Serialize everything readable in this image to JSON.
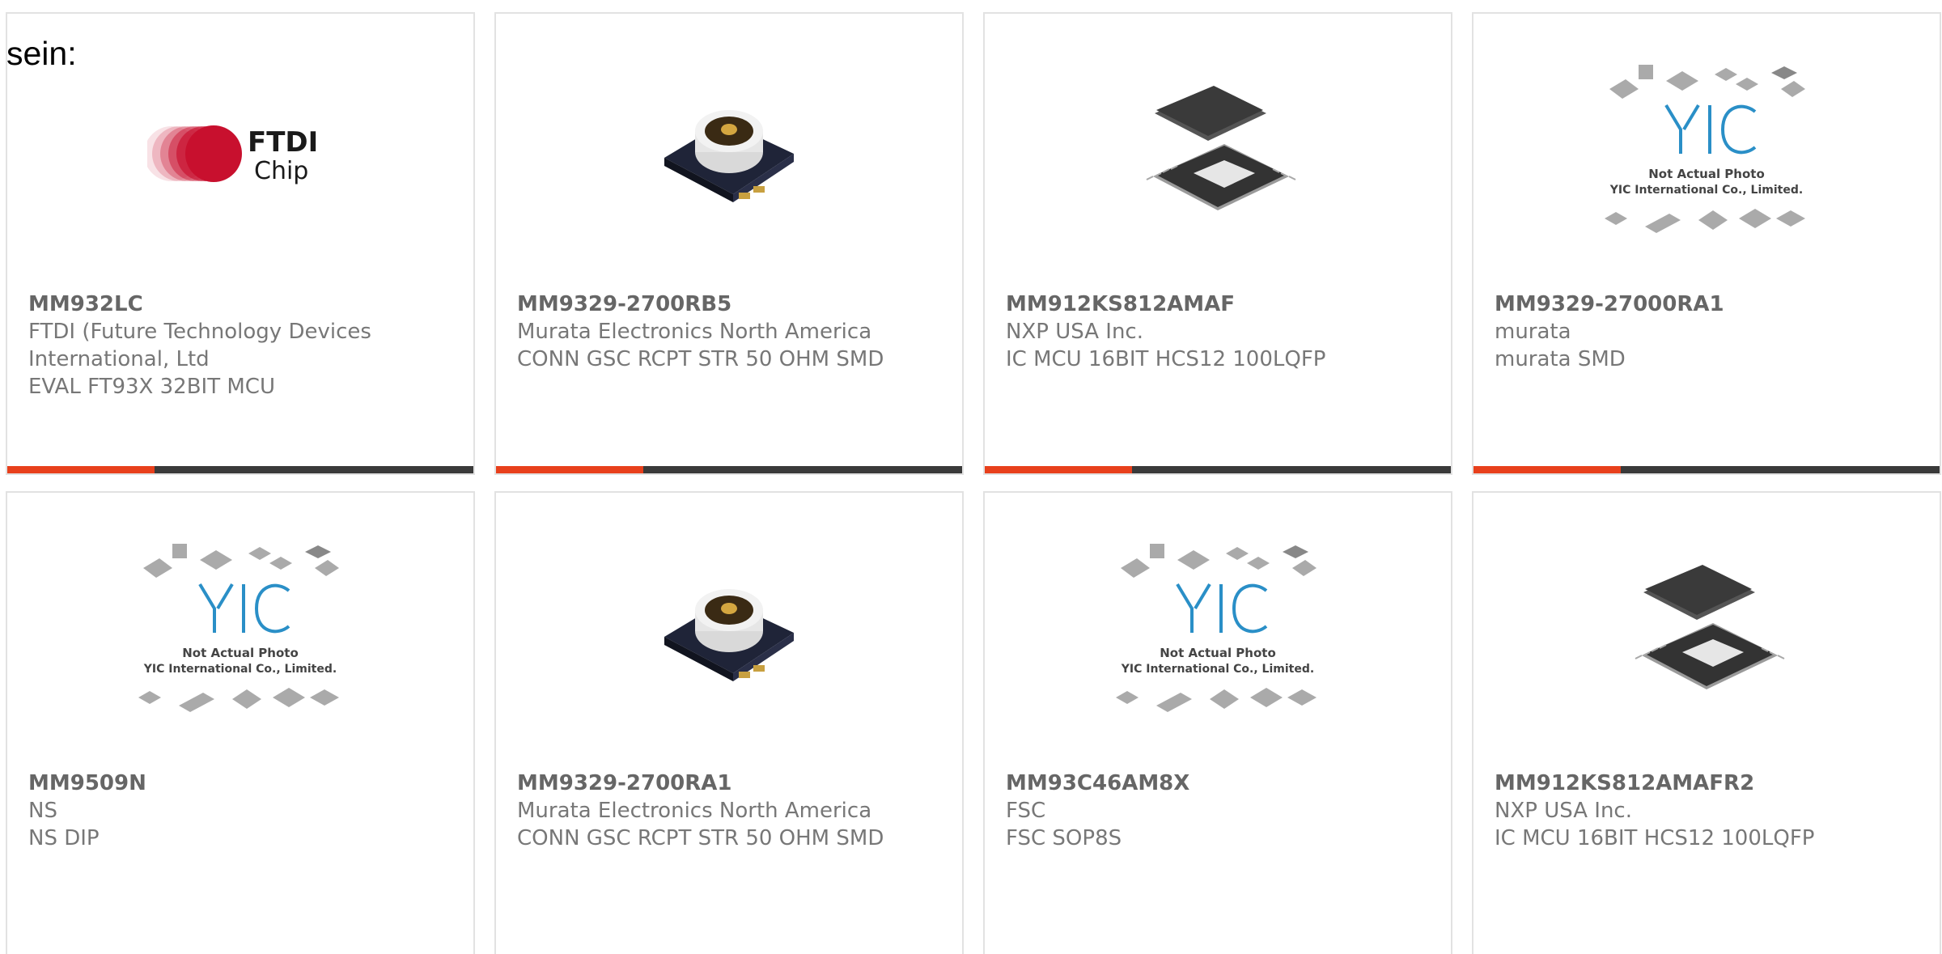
{
  "section_label": "sein:",
  "colors": {
    "accent": "#e8401c",
    "bar_dark": "#3a3a3a",
    "text": "#777777",
    "yic_blue": "#2a8fc7"
  },
  "products": [
    {
      "part": "MM932LC",
      "manufacturer": "FTDI (Future Technology Devices International, Ltd",
      "description": "EVAL FT93X 32BIT MCU",
      "image": "ftdi-chip-logo",
      "logo_text_1": "FTDI",
      "logo_text_2": "Chip"
    },
    {
      "part": "MM9329-2700RB5",
      "manufacturer": "Murata Electronics North America",
      "description": "CONN GSC RCPT STR 50 OHM SMD",
      "image": "rf-connector-photo"
    },
    {
      "part": "MM912KS812AMAF",
      "manufacturer": "NXP USA Inc.",
      "description": "IC MCU 16BIT HCS12 100LQFP",
      "image": "qfp-chip-photo"
    },
    {
      "part": "MM9329-27000RA1",
      "manufacturer": "murata",
      "description": "murata SMD",
      "image": "yic-placeholder",
      "placeholder_line_1": "Not Actual Photo",
      "placeholder_line_2": "YIC International Co., Limited."
    },
    {
      "part": "MM9509N",
      "manufacturer": "NS",
      "description": "NS DIP",
      "image": "yic-placeholder",
      "placeholder_line_1": "Not Actual Photo",
      "placeholder_line_2": "YIC International Co., Limited."
    },
    {
      "part": "MM9329-2700RA1",
      "manufacturer": "Murata Electronics North America",
      "description": "CONN GSC RCPT STR 50 OHM SMD",
      "image": "rf-connector-photo"
    },
    {
      "part": "MM93C46AM8X",
      "manufacturer": "FSC",
      "description": "FSC SOP8S",
      "image": "yic-placeholder",
      "placeholder_line_1": "Not Actual Photo",
      "placeholder_line_2": "YIC International Co., Limited."
    },
    {
      "part": "MM912KS812AMAFR2",
      "manufacturer": "NXP USA Inc.",
      "description": "IC MCU 16BIT HCS12 100LQFP",
      "image": "qfp-chip-photo"
    }
  ]
}
